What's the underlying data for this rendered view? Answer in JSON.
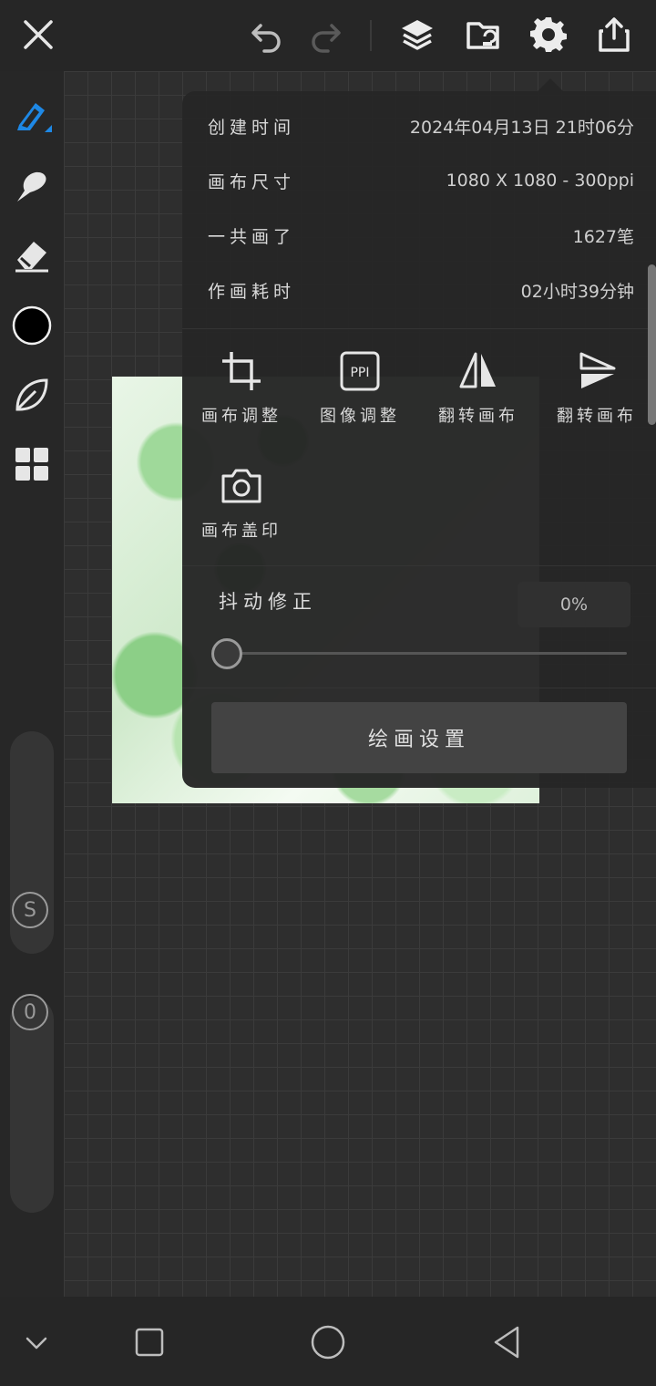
{
  "toolbar": {
    "icons": [
      "close-icon",
      "undo-icon",
      "redo-icon",
      "layers-icon",
      "folder-icon",
      "gear-icon",
      "share-icon"
    ]
  },
  "left_tools": {
    "icons": [
      "pen-brush-icon",
      "smudge-icon",
      "eraser-icon",
      "color-swatch",
      "leaf-icon",
      "grid-icon"
    ],
    "color": "#000000",
    "size_knob_label": "S",
    "opacity_knob_label": "0"
  },
  "canvas_info": {
    "created_label": "创建时间",
    "created_value": "2024年04月13日 21时06分",
    "size_label": "画布尺寸",
    "size_value": "1080 X 1080 - 300ppi",
    "strokes_label": "一共画了",
    "strokes_value": "1627笔",
    "duration_label": "作画耗时",
    "duration_value": "02小时39分钟"
  },
  "tools": [
    {
      "label": "画布调整",
      "icon": "crop-icon"
    },
    {
      "label": "图像调整",
      "icon": "ppi-icon",
      "icon_text": "PPI"
    },
    {
      "label": "翻转画布",
      "icon": "flip-horizontal-icon"
    },
    {
      "label": "翻转画布",
      "icon": "flip-vertical-icon"
    },
    {
      "label": "画布盖印",
      "icon": "camera-icon"
    }
  ],
  "stabilizer": {
    "label": "抖动修正",
    "value": "0%",
    "level": 0
  },
  "drawing_settings_button": "绘画设置",
  "colors": {
    "accent": "#1e88e5",
    "panel": "#262626",
    "button": "#434343"
  }
}
